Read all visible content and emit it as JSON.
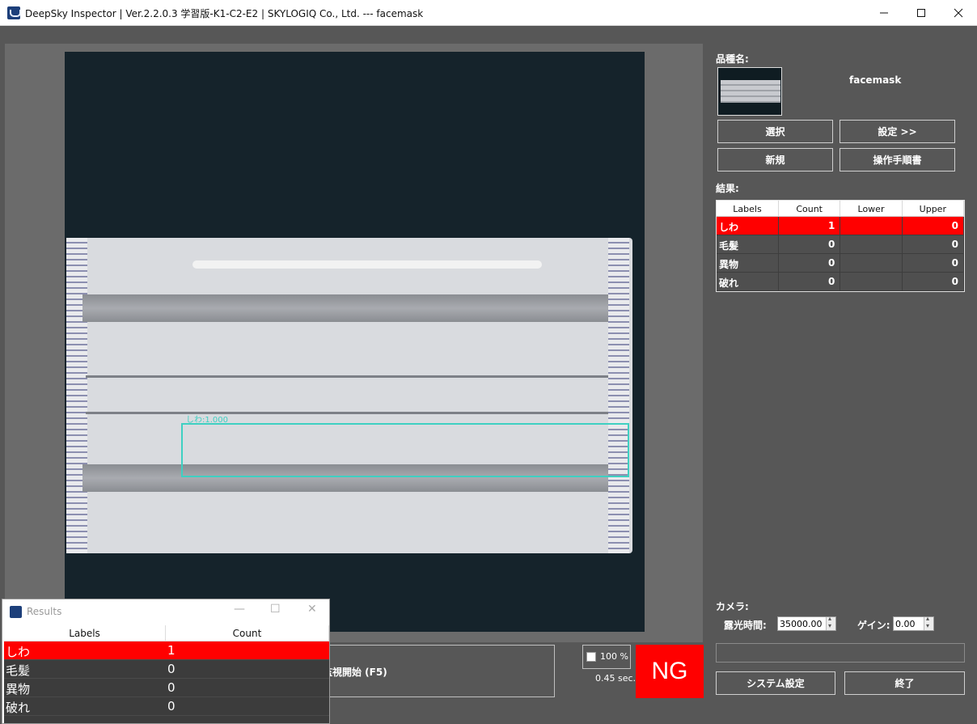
{
  "window": {
    "title": "DeepSky Inspector | Ver.2.2.0.3 学習版-K1-C2-E2 | SKYLOGIQ Co., Ltd. --- facemask"
  },
  "viewer": {
    "detection_label": "しわ:1.000"
  },
  "controls": {
    "start_label": "監視開始 (F5)",
    "zoom_label": "100 %",
    "elapsed": "0.45 sec.",
    "judgement": "NG"
  },
  "panel": {
    "product_label": "品種名:",
    "product_name": "facemask",
    "select_button": "選択",
    "settings_button": "設定 >>",
    "new_button": "新規",
    "manual_button": "操作手順書",
    "result_label": "結果:",
    "table_headers": [
      "Labels",
      "Count",
      "Lower",
      "Upper"
    ],
    "rows": [
      {
        "label": "しわ",
        "count": "1",
        "lower": "",
        "upper": "0",
        "ng": true
      },
      {
        "label": "毛髪",
        "count": "0",
        "lower": "",
        "upper": "0",
        "ng": false
      },
      {
        "label": "異物",
        "count": "0",
        "lower": "",
        "upper": "0",
        "ng": false
      },
      {
        "label": "破れ",
        "count": "0",
        "lower": "",
        "upper": "0",
        "ng": false
      }
    ],
    "camera_label": "カメラ:",
    "exposure_label": "露光時間:",
    "exposure_value": "35000.00",
    "gain_label": "ゲイン:",
    "gain_value": "0.00",
    "system_button": "システム設定",
    "exit_button": "終了"
  },
  "results_window": {
    "title": "Results",
    "headers": [
      "Labels",
      "Count"
    ],
    "rows": [
      {
        "label": "しわ",
        "count": "1",
        "ng": true
      },
      {
        "label": "毛髪",
        "count": "0",
        "ng": false
      },
      {
        "label": "異物",
        "count": "0",
        "ng": false
      },
      {
        "label": "破れ",
        "count": "0",
        "ng": false
      }
    ]
  },
  "colors": {
    "ng_red": "#ff0000",
    "detection_box": "#3fd0c2",
    "background": "#575757"
  }
}
